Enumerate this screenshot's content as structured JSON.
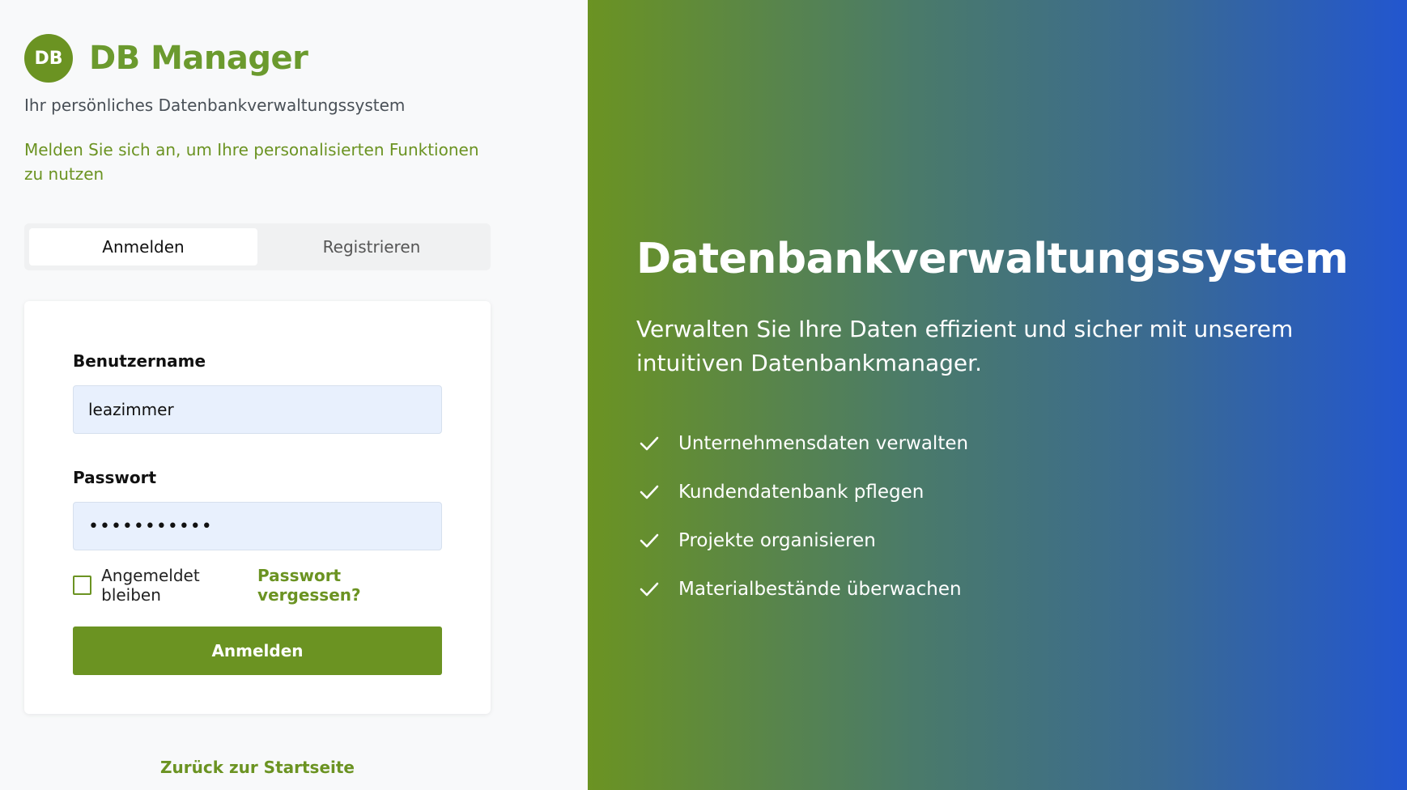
{
  "brand": {
    "logo_text": "DB",
    "name": "DB Manager"
  },
  "subtitle": "Ihr persönliches Datenbankverwaltungssystem",
  "login_hint": "Melden Sie sich an, um Ihre personalisierten Funktionen zu nutzen",
  "tabs": [
    {
      "label": "Anmelden",
      "active": true
    },
    {
      "label": "Registrieren",
      "active": false
    }
  ],
  "form": {
    "username_label": "Benutzername",
    "username_value": "leazimmer",
    "password_label": "Passwort",
    "password_masked": "•••••••••••",
    "remember_label": "Angemeldet bleiben",
    "remember_checked": false,
    "forgot_link": "Passwort vergessen?",
    "submit_label": "Anmelden"
  },
  "back_link": "Zurück zur Startseite",
  "hero": {
    "title": "Datenbankverwaltungssystem",
    "description": "Verwalten Sie Ihre Daten effizient und sicher mit unserem intuitiven Datenbankmanager.",
    "features": [
      {
        "icon": "check-icon",
        "label": "Unternehmensdaten verwalten"
      },
      {
        "icon": "check-icon",
        "label": "Kundendatenbank pflegen"
      },
      {
        "icon": "check-icon",
        "label": "Projekte organisieren"
      },
      {
        "icon": "check-icon",
        "label": "Materialbestände überwachen"
      }
    ]
  },
  "colors": {
    "accent": "#6b9322",
    "input_bg": "#e8f0fd",
    "gradient_start": "#6b9322",
    "gradient_end": "#2256cf"
  }
}
